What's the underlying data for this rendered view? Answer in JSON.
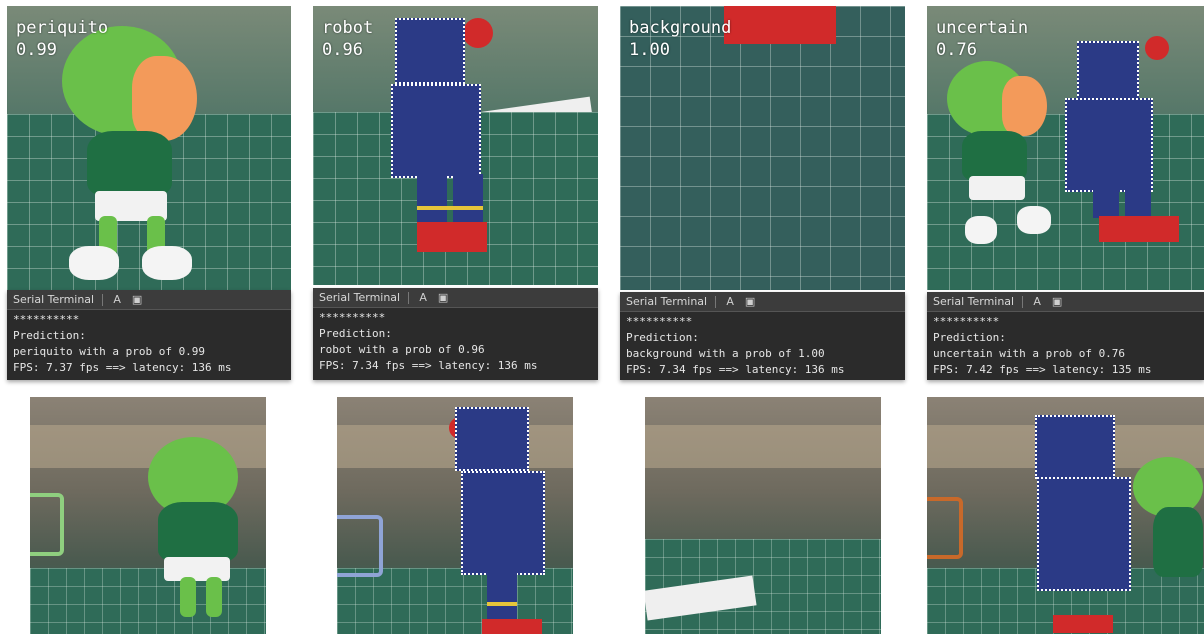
{
  "panels": [
    {
      "label": "periquito",
      "prob": "0.99",
      "terminal": {
        "title": "Serial Terminal",
        "separator": "**********",
        "prediction_header": "Prediction:",
        "prediction_line": "periquito with a prob of 0.99",
        "fps_line": "FPS: 7.37 fps ==> latency: 136 ms"
      }
    },
    {
      "label": "robot",
      "prob": "0.96",
      "terminal": {
        "title": "Serial Terminal",
        "separator": "**********",
        "prediction_header": "Prediction:",
        "prediction_line": "robot with a prob of 0.96",
        "fps_line": "FPS: 7.34 fps ==> latency: 136 ms"
      }
    },
    {
      "label": "background",
      "prob": "1.00",
      "terminal": {
        "title": "Serial Terminal",
        "separator": "**********",
        "prediction_header": "Prediction:",
        "prediction_line": "background with a prob of 1.00",
        "fps_line": "FPS: 7.34 fps ==> latency: 136 ms"
      }
    },
    {
      "label": "uncertain",
      "prob": "0.76",
      "terminal": {
        "title": "Serial Terminal",
        "separator": "**********",
        "prediction_header": "Prediction:",
        "prediction_line": "uncertain with a prob of 0.76",
        "fps_line": "FPS: 7.42 fps ==> latency: 135 ms"
      }
    }
  ],
  "icons": {
    "terminal_font": "text-size-icon",
    "terminal_save": "save-icon"
  },
  "bounding_box_colors": {
    "periquito": "#8fcf7f",
    "robot": "#8fa4d6",
    "uncertain": "#c8692a"
  }
}
